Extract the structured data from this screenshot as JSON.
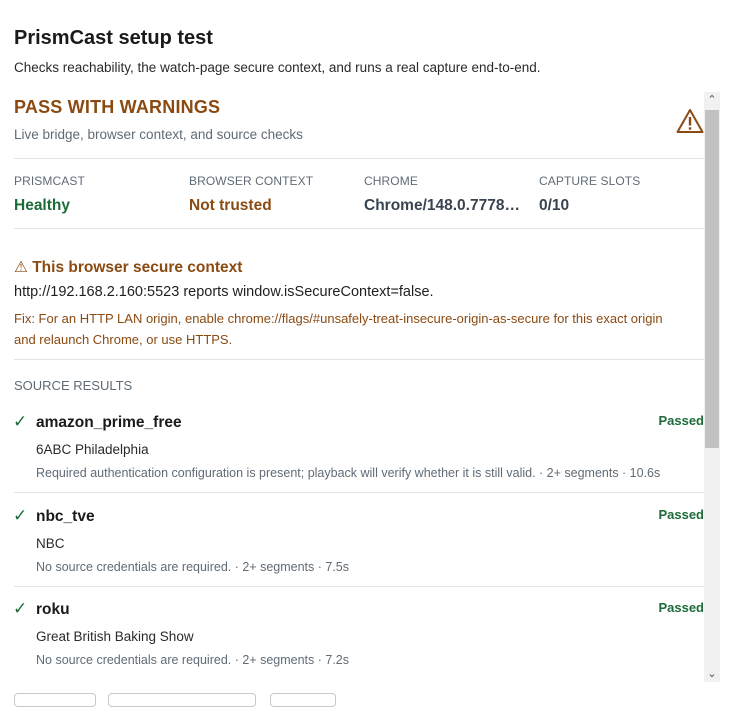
{
  "dialog": {
    "title": "PrismCast setup test",
    "subtitle": "Checks reachability, the watch-page secure context, and runs a real capture end-to-end."
  },
  "status": {
    "title": "PASS WITH WARNINGS",
    "subtitle": "Live bridge, browser context, and source checks",
    "icon": "warning-icon",
    "color": "#8a4a12"
  },
  "metrics": [
    {
      "label": "PRISMCAST",
      "value": "Healthy",
      "color": "#1e6b3a"
    },
    {
      "label": "BROWSER CONTEXT",
      "value": "Not trusted",
      "color": "#8a4a12"
    },
    {
      "label": "CHROME",
      "value": "Chrome/148.0.7778.…",
      "color": "#3a4450"
    },
    {
      "label": "CAPTURE SLOTS",
      "value": "0/10",
      "color": "#3a4450"
    }
  ],
  "alert": {
    "title": "This browser secure context",
    "icon": "warning-icon",
    "message": "http://192.168.2.160:5523 reports window.isSecureContext=false.",
    "fix": "Fix: For an HTTP LAN origin, enable chrome://flags/#unsafely-treat-insecure-origin-as-secure for this exact origin and relaunch Chrome, or use HTTPS."
  },
  "sources": {
    "label": "SOURCE RESULTS",
    "results": [
      {
        "name": "amazon_prime_free",
        "channel": "6ABC Philadelphia",
        "detail": "Required authentication configuration is present; playback will verify whether it is still valid. · 2+ segments · 10.6s",
        "status": "Passed"
      },
      {
        "name": "nbc_tve",
        "channel": "NBC",
        "detail": "No source credentials are required. · 2+ segments · 7.5s",
        "status": "Passed"
      },
      {
        "name": "roku",
        "channel": "Great British Baking Show",
        "detail": "No source credentials are required. · 2+ segments · 7.2s",
        "status": "Passed"
      }
    ]
  },
  "colors": {
    "pass": "#1e6b3a",
    "warn": "#8a4a12",
    "muted": "#5f6b76"
  }
}
